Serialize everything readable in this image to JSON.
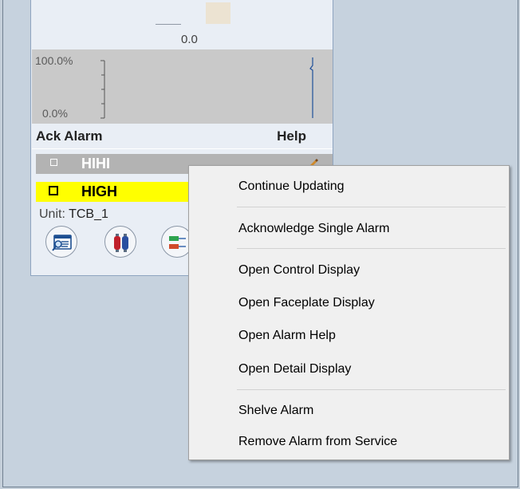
{
  "faceplate": {
    "pv_value": "0.0",
    "trend_max": "100.0%",
    "trend_min": "0.0%",
    "header_ack_alarm": "Ack Alarm",
    "header_help": "Help",
    "alarms": [
      {
        "label": "HIHI",
        "color": "#b3b3b3"
      },
      {
        "label": "HIGH",
        "color": "#ffff00"
      }
    ],
    "unit_label": "Unit:",
    "unit_value": "TCB_1",
    "nav_buttons": [
      {
        "icon": "detail-display-icon"
      },
      {
        "icon": "faceplate-display-icon"
      },
      {
        "icon": "control-display-icon"
      }
    ]
  },
  "context_menu": {
    "items": [
      "Continue Updating",
      "Acknowledge Single Alarm",
      "Open Control Display",
      "Open Faceplate Display",
      "Open Alarm Help",
      "Open Detail Display",
      "Shelve Alarm",
      "Remove Alarm from Service"
    ]
  },
  "colors": {
    "desktop": "#c6d2de",
    "faceplate_bg": "#e9eef5",
    "trend_bg": "#c9c9c9",
    "hihi": "#b3b3b3",
    "high": "#ffff00",
    "menu_bg": "#f0f0f0"
  }
}
